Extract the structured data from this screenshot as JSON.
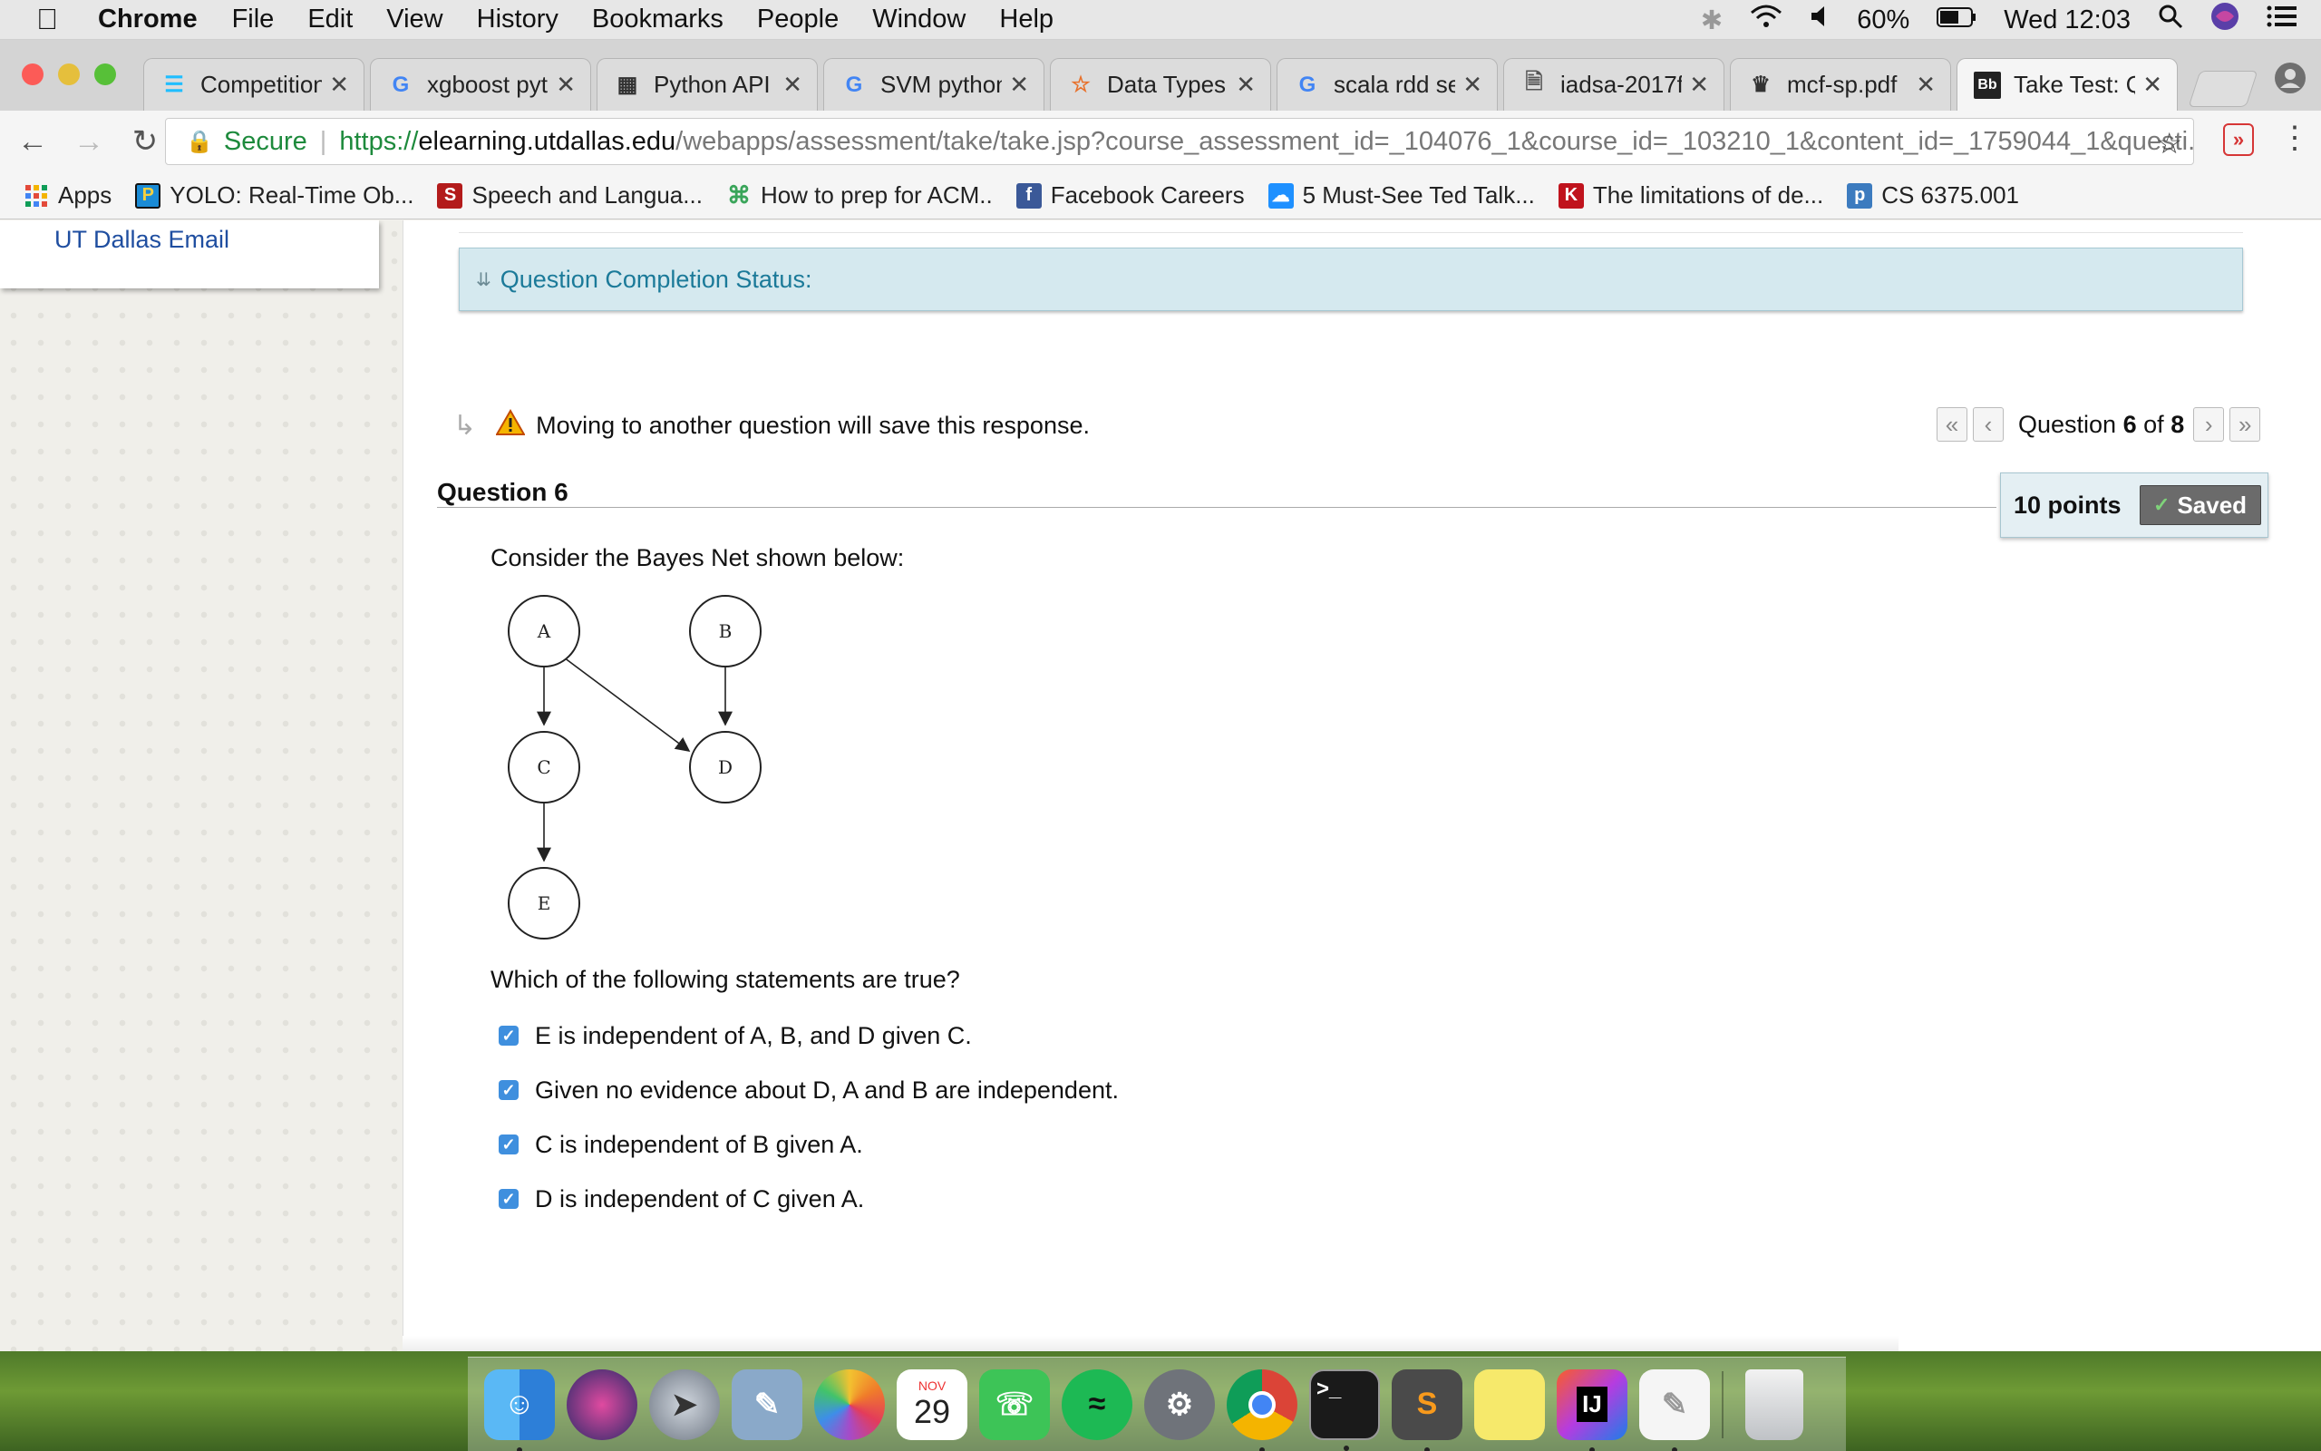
{
  "menubar": {
    "app": "Chrome",
    "items": [
      "File",
      "Edit",
      "View",
      "History",
      "Bookmarks",
      "People",
      "Window",
      "Help"
    ],
    "battery": "60%",
    "clock": "Wed 12:03"
  },
  "tabs": [
    {
      "title": "Competition",
      "icon": "kaggle-icon"
    },
    {
      "title": "xgboost pyth",
      "icon": "google-icon"
    },
    {
      "title": "Python API –",
      "icon": "docs-icon"
    },
    {
      "title": "SVM python",
      "icon": "google-icon"
    },
    {
      "title": "Data Types -",
      "icon": "star-icon"
    },
    {
      "title": "scala rdd sel",
      "icon": "google-icon"
    },
    {
      "title": "iadsa-2017f-",
      "icon": "document-icon"
    },
    {
      "title": "mcf-sp.pdf",
      "icon": "crown-icon"
    },
    {
      "title": "Take Test: Q",
      "icon": "blackboard-icon"
    }
  ],
  "address": {
    "secure_label": "Secure",
    "url_scheme": "https://",
    "url_host": "elearning.utdallas.edu",
    "url_path": "/webapps/assessment/take/take.jsp?course_assessment_id=_104076_1&course_id=_103210_1&content_id=_1759044_1&questi..."
  },
  "bookmarks": [
    {
      "label": "Apps",
      "color": "#e34a3a"
    },
    {
      "label": "YOLO: Real-Time Ob...",
      "color": "#1a8bd6"
    },
    {
      "label": "Speech and Langua...",
      "color": "#b31b1b"
    },
    {
      "label": "How to prep for ACM..",
      "color": "#3aa55a"
    },
    {
      "label": "Facebook Careers",
      "color": "#3b5998"
    },
    {
      "label": "5 Must-See Ted Talk...",
      "color": "#1e90ff"
    },
    {
      "label": "The limitations of de...",
      "color": "#c0131d"
    },
    {
      "label": "CS 6375.001",
      "color": "#3c7bbf"
    }
  ],
  "sidebar": {
    "email_link": "UT Dallas Email"
  },
  "status_panel": {
    "label": "Question Completion Status:"
  },
  "warning": {
    "text": "Moving to another question will save this response."
  },
  "pager": {
    "prefix": "Question",
    "current": "6",
    "of": "of",
    "total": "8"
  },
  "question": {
    "title": "Question 6",
    "points": "10 points",
    "saved": "Saved",
    "text": "Consider the Bayes Net shown below:",
    "sub": "Which of the following statements are true?",
    "answers": [
      "E is independent of A, B, and D given C.",
      "Given no evidence about D, A and B are independent.",
      "C is independent of B given A.",
      "D is independent of C given A."
    ]
  },
  "bayes_net": {
    "nodes": [
      "A",
      "B",
      "C",
      "D",
      "E"
    ]
  },
  "dock": {
    "calendar_month": "NOV",
    "calendar_day": "29"
  }
}
